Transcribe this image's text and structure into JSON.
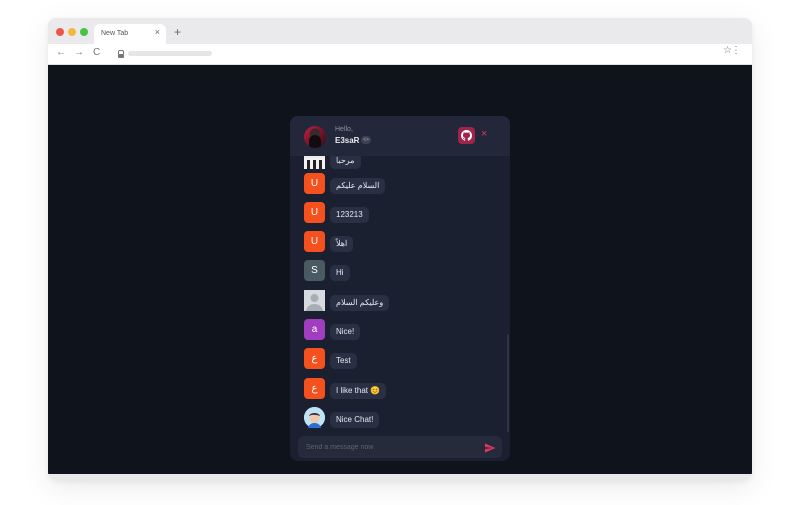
{
  "browser": {
    "tab_title": "New Tab",
    "tab_close": "×",
    "new_tab": "+",
    "nav_back": "←",
    "nav_forward": "→",
    "nav_reload": "C",
    "star": "☆",
    "menu": "⋮"
  },
  "chat": {
    "header": {
      "greeting": "Hello,",
      "username": "E3saR",
      "username_badge": "<>",
      "close": "×"
    },
    "colors": {
      "accent": "#e0355c",
      "github_bg": "#a0234a",
      "orange": "#f4511e",
      "slate": "#4a5a63",
      "purple": "#a13ebf",
      "panel": "#1b2030",
      "bubble": "#2a3043"
    },
    "messages": [
      {
        "avatar_letter": "",
        "avatar_type": "image",
        "text": "مرحبا"
      },
      {
        "avatar_letter": "U",
        "avatar_type": "letter",
        "text": "السلام عليكم"
      },
      {
        "avatar_letter": "U",
        "avatar_type": "letter",
        "text": "123213"
      },
      {
        "avatar_letter": "U",
        "avatar_type": "letter",
        "text": "اهلاً"
      },
      {
        "avatar_letter": "S",
        "avatar_type": "letter",
        "text": "Hi"
      },
      {
        "avatar_letter": "",
        "avatar_type": "default-user",
        "text": "وعليكم السلام"
      },
      {
        "avatar_letter": "a",
        "avatar_type": "letter",
        "text": "Nice!"
      },
      {
        "avatar_letter": "ع",
        "avatar_type": "letter",
        "text": "Test"
      },
      {
        "avatar_letter": "ع",
        "avatar_type": "letter",
        "text": "I like that 😊"
      },
      {
        "avatar_letter": "",
        "avatar_type": "illustration",
        "text": "Nice Chat!"
      }
    ],
    "composer": {
      "placeholder": "Send a message now"
    }
  }
}
